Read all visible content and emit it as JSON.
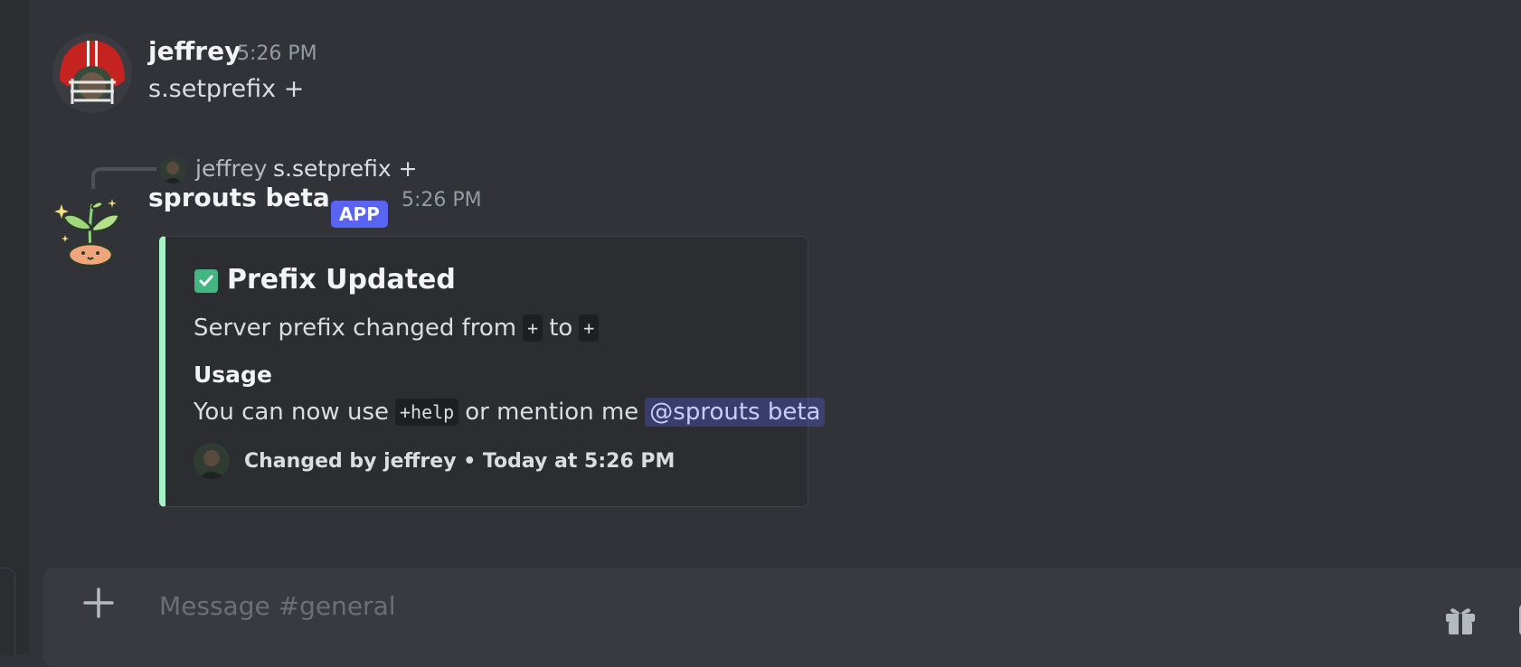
{
  "messages": [
    {
      "author": "jeffrey",
      "timestamp": "5:26 PM",
      "content": "s.setprefix +"
    }
  ],
  "reply": {
    "author": "jeffrey",
    "content": "s.setprefix +"
  },
  "bot_message": {
    "author": "sprouts beta",
    "badge": "APP",
    "timestamp": "5:26 PM",
    "embed": {
      "accent_color": "#a6f1c6",
      "title_icon": "check-box-icon",
      "title": "Prefix Updated",
      "description_prefix": "Server prefix changed from",
      "old_prefix": "+",
      "description_middle": "to",
      "new_prefix": "+",
      "field_name": "Usage",
      "field_value_prefix": "You can now use",
      "help_command": "+help",
      "field_value_middle": "or mention me",
      "mention": "@sprouts beta",
      "footer": "Changed by jeffrey • Today at 5:26 PM"
    }
  },
  "composer": {
    "placeholder": "Message #general",
    "plus_icon": "plus-icon",
    "gift_icon": "gift-icon"
  },
  "colors": {
    "background": "#313338",
    "embed_bg": "#2b2d31",
    "badge": "#5865f2",
    "mention_bg": "#5865f2"
  }
}
